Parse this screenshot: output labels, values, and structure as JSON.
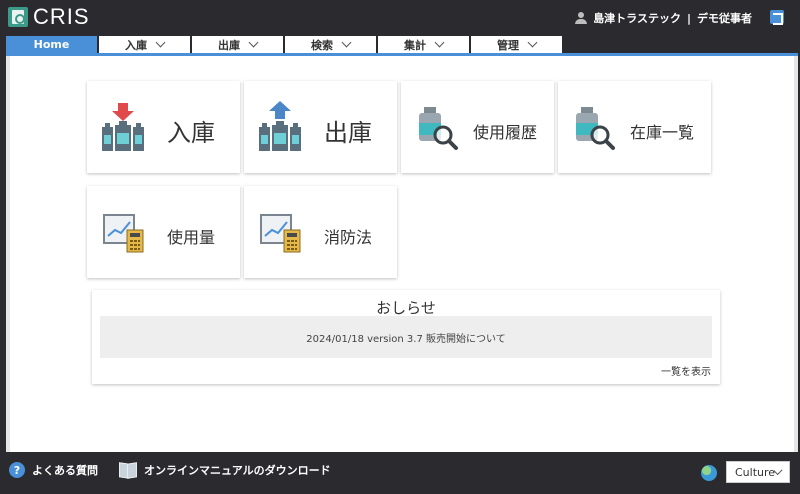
{
  "app": {
    "title": "CRIS"
  },
  "user": {
    "company": "島津トラステック",
    "separator": "|",
    "name": "デモ従事者"
  },
  "nav": {
    "tabs": [
      {
        "label": "Home",
        "active": true
      },
      {
        "label": "入庫"
      },
      {
        "label": "出庫"
      },
      {
        "label": "検索"
      },
      {
        "label": "集計"
      },
      {
        "label": "管理"
      }
    ]
  },
  "tiles": [
    {
      "label": "入庫",
      "icon": "receive-bottles-icon"
    },
    {
      "label": "出庫",
      "icon": "issue-bottles-icon"
    },
    {
      "label": "使用履歴",
      "icon": "usage-history-search-icon"
    },
    {
      "label": "在庫一覧",
      "icon": "inventory-search-icon"
    },
    {
      "label": "使用量",
      "icon": "usage-chart-calculator-icon"
    },
    {
      "label": "消防法",
      "icon": "fire-law-chart-calculator-icon"
    }
  ],
  "notice": {
    "title": "おしらせ",
    "items": [
      "2024/01/18 version 3.7 販売開始について"
    ],
    "more_label": "一覧を表示"
  },
  "footer": {
    "faq_label": "よくある質問",
    "faq_icon_glyph": "?",
    "manual_label": "オンラインマニュアルのダウンロード",
    "culture_label": "Culture"
  },
  "colors": {
    "accent": "#4a90d9",
    "header_bg": "#2b2b2f",
    "receive_arrow": "#e04a4a",
    "issue_arrow": "#4a86c8",
    "bottle_label": "#6ed0d6"
  }
}
